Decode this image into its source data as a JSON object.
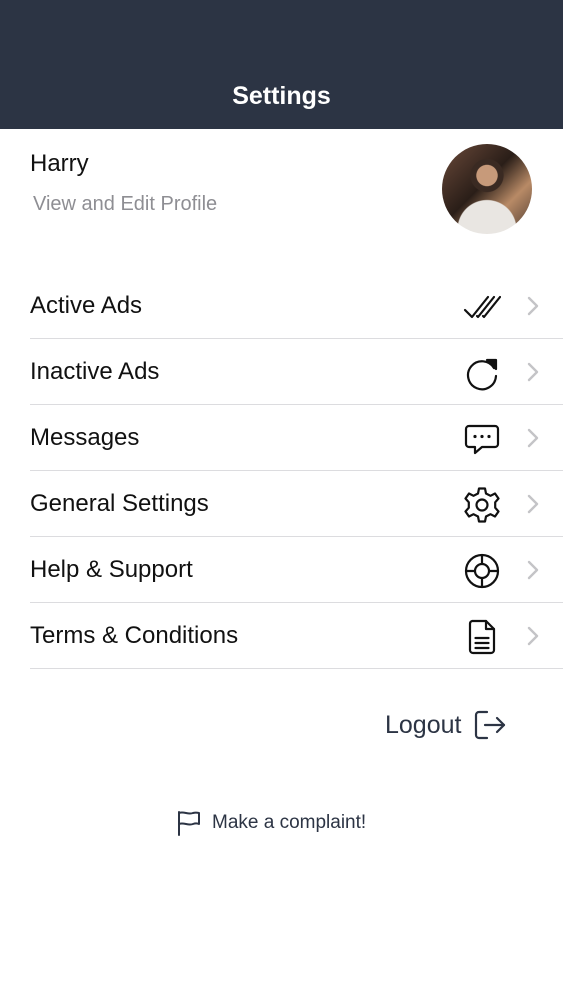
{
  "header": {
    "title": "Settings"
  },
  "profile": {
    "name": "Harry",
    "subtitle": "View and Edit Profile"
  },
  "menu": [
    {
      "label": "Active Ads",
      "icon": "double-check-icon"
    },
    {
      "label": "Inactive Ads",
      "icon": "refresh-icon"
    },
    {
      "label": "Messages",
      "icon": "chat-bubble-icon"
    },
    {
      "label": "General Settings",
      "icon": "gear-icon"
    },
    {
      "label": "Help & Support",
      "icon": "lifebuoy-icon"
    },
    {
      "label": "Terms & Conditions",
      "icon": "document-icon"
    }
  ],
  "logout": {
    "label": "Logout",
    "icon": "logout-icon"
  },
  "complaint": {
    "label": "Make a complaint!",
    "icon": "flag-icon"
  },
  "colors": {
    "header_bg": "#2c3444",
    "divider": "#dcdcdf",
    "subtitle": "#8e8e93"
  }
}
